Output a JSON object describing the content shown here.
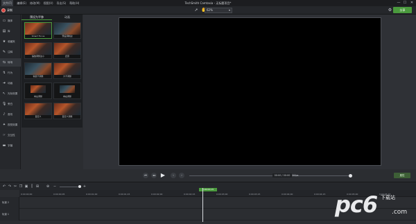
{
  "titlebar": {
    "menu": [
      "文件(F)",
      "编辑(E)",
      "修改(M)",
      "视图(V)",
      "导出(S)",
      "帮助(H)"
    ],
    "title": "TechSmith Camtasia - 无标题项目*",
    "min": "—",
    "max": "☐",
    "close": "✕"
  },
  "toolbar": {
    "record_label": "录制",
    "zoom_value": "62%",
    "share_label": "分享"
  },
  "sidebar": {
    "items": [
      {
        "label": "媒体",
        "icon": "media-icon"
      },
      {
        "label": "库",
        "icon": "library-icon"
      },
      {
        "label": "收藏夹",
        "icon": "star-icon"
      },
      {
        "label": "注释",
        "icon": "annotation-icon"
      },
      {
        "label": "转场",
        "icon": "transition-icon"
      },
      {
        "label": "行为",
        "icon": "behavior-icon"
      },
      {
        "label": "动画",
        "icon": "animation-icon"
      },
      {
        "label": "光标效果",
        "icon": "cursor-icon"
      },
      {
        "label": "旁白",
        "icon": "voice-icon"
      },
      {
        "label": "音效",
        "icon": "audio-icon"
      },
      {
        "label": "视觉效果",
        "icon": "visual-effects-icon"
      },
      {
        "label": "交互性",
        "icon": "interactive-icon"
      },
      {
        "label": "字幕",
        "icon": "captions-icon"
      }
    ]
  },
  "panel": {
    "tabs": [
      "预设为平移",
      "动画"
    ],
    "thumbs": [
      {
        "caption": "Smart Focus"
      },
      {
        "caption": "预设调制边"
      },
      {
        "caption": "缩放调整边小"
      },
      {
        "caption": "还原"
      },
      {
        "caption": "恢复不调整"
      },
      {
        "caption": "大不调整"
      },
      {
        "caption": "向左调整"
      },
      {
        "caption": "向右调整"
      },
      {
        "caption": "自定义"
      },
      {
        "caption": "自定义调整"
      }
    ]
  },
  "playback": {
    "timecode": "00:00 / 00:00",
    "fps": "30fps",
    "properties_label": "属性"
  },
  "timeline": {
    "playhead": "0:00:00;15",
    "ticks": [
      "0:00:00;00",
      "0:00:00;05",
      "0:00:01;00",
      "0:00:01;15",
      "0:00:02;00",
      "0:00:02;15",
      "0:00:03;00",
      "0:00:03;15",
      "0:00:04;00",
      "0:00:04;15",
      "0:00:05;00",
      "0:00:05;15"
    ],
    "tracks": [
      "轨道 2",
      "轨道 1"
    ]
  },
  "watermark": {
    "brand": "pc6",
    "sub": "下载站",
    "domain": ".com"
  },
  "colors": {
    "accent": "#4a9a3d",
    "record": "#d8403b"
  }
}
